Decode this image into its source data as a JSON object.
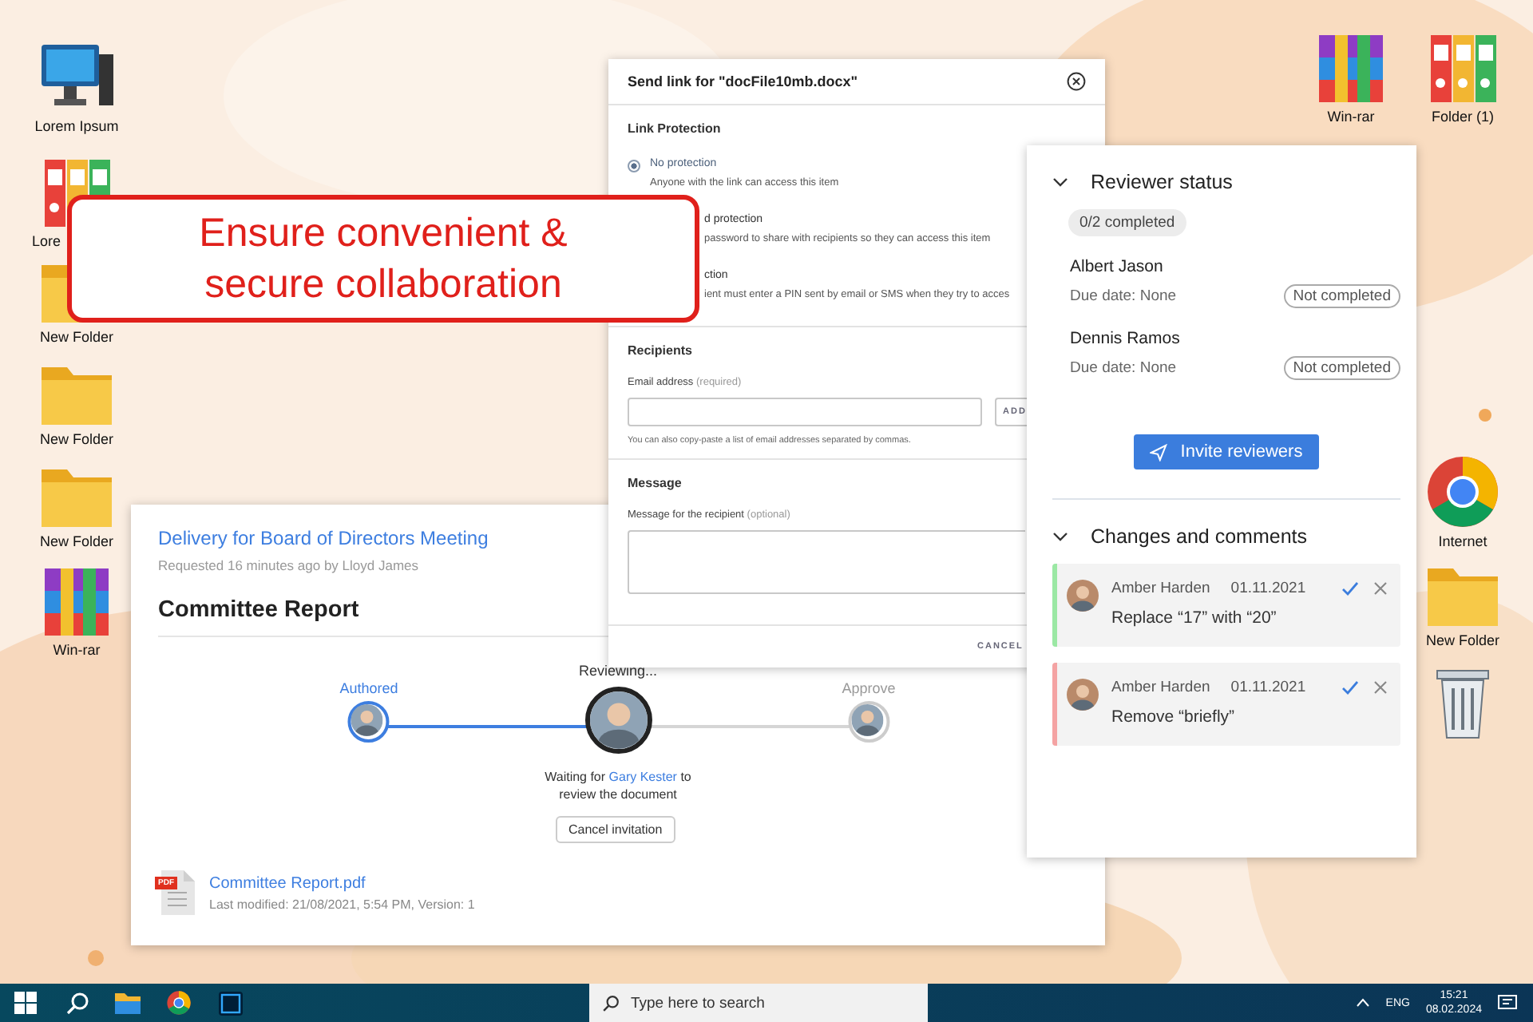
{
  "desktop_icons": [
    {
      "label": "Lorem Ipsum",
      "kind": "computer"
    },
    {
      "label": "Lore",
      "kind": "binders"
    },
    {
      "label": "New Folder",
      "kind": "folder"
    },
    {
      "label": "New Folder",
      "kind": "folder"
    },
    {
      "label": "New Folder",
      "kind": "folder"
    },
    {
      "label": "Win-rar",
      "kind": "archive"
    },
    {
      "label": "Win-rar",
      "kind": "archive"
    },
    {
      "label": "Folder (1)",
      "kind": "binders"
    },
    {
      "label": "Internet",
      "kind": "browser"
    },
    {
      "label": "New Folder",
      "kind": "folder"
    },
    {
      "kind": "bin"
    }
  ],
  "callout": {
    "text": "Ensure convenient &\nsecure collaboration"
  },
  "send_dialog": {
    "title": "Send link for \"docFile10mb.docx\"",
    "link_protection": {
      "heading": "Link Protection",
      "options": [
        {
          "label": "No protection",
          "description": "Anyone with the link can access this item",
          "selected": true
        },
        {
          "label": "d protection",
          "description": "password to share with recipients so they can access this item"
        },
        {
          "label": "ction",
          "description": "ient must enter a PIN sent by email or SMS when they try to acces"
        }
      ]
    },
    "recipients": {
      "heading": "Recipients",
      "field_label": "Email address",
      "field_hint": "(required)",
      "add_button": "ADD",
      "note": "You can also copy-paste a list of email addresses separated by commas."
    },
    "message": {
      "heading": "Message",
      "field_label": "Message for the recipient",
      "field_hint": "(optional)"
    },
    "cancel_button": "CANCEL"
  },
  "delivery": {
    "title": "Delivery for Board of Directors Meeting",
    "requested": "Requested 16 minutes ago by Lloyd James",
    "heading": "Committee Report",
    "steps": [
      {
        "label": "Authored",
        "done": true,
        "current": false
      },
      {
        "label": "Reviewing...",
        "done": false,
        "current": true
      },
      {
        "label": "Approve",
        "done": false,
        "current": false
      }
    ],
    "waiting_prefix": "Waiting for",
    "waiting_link": "Gary Kester",
    "waiting_suffix": "to review the document",
    "cancel_button": "Cancel invitation",
    "file": {
      "name": "Committee Report.pdf",
      "meta": "Last modified: 21/08/2021, 5:54 PM, Version: 1",
      "badge": "PDF"
    }
  },
  "review_panel": {
    "reviewer_status": {
      "heading": "Reviewer status",
      "expanded": true,
      "progress": "0/2 completed",
      "reviewers": [
        {
          "name": "Albert Jason",
          "due": "Due date: None",
          "status": "Not completed"
        },
        {
          "name": "Dennis Ramos",
          "due": "Due date: None",
          "status": "Not completed"
        }
      ],
      "invite_button": "Invite reviewers"
    },
    "changes": {
      "heading": "Changes and comments",
      "expanded": true,
      "comments": [
        {
          "author": "Amber Harden",
          "date": "01.11.2021",
          "text": "Replace “17” with “20”",
          "color": "#9be8a4"
        },
        {
          "author": "Amber Harden",
          "date": "01.11.2021",
          "text": "Remove “briefly”",
          "color": "#f4a3a3"
        }
      ]
    }
  },
  "taskbar": {
    "search_placeholder": "Type here to search",
    "language": "ENG",
    "time": "15:21",
    "date": "08.02.2024"
  }
}
